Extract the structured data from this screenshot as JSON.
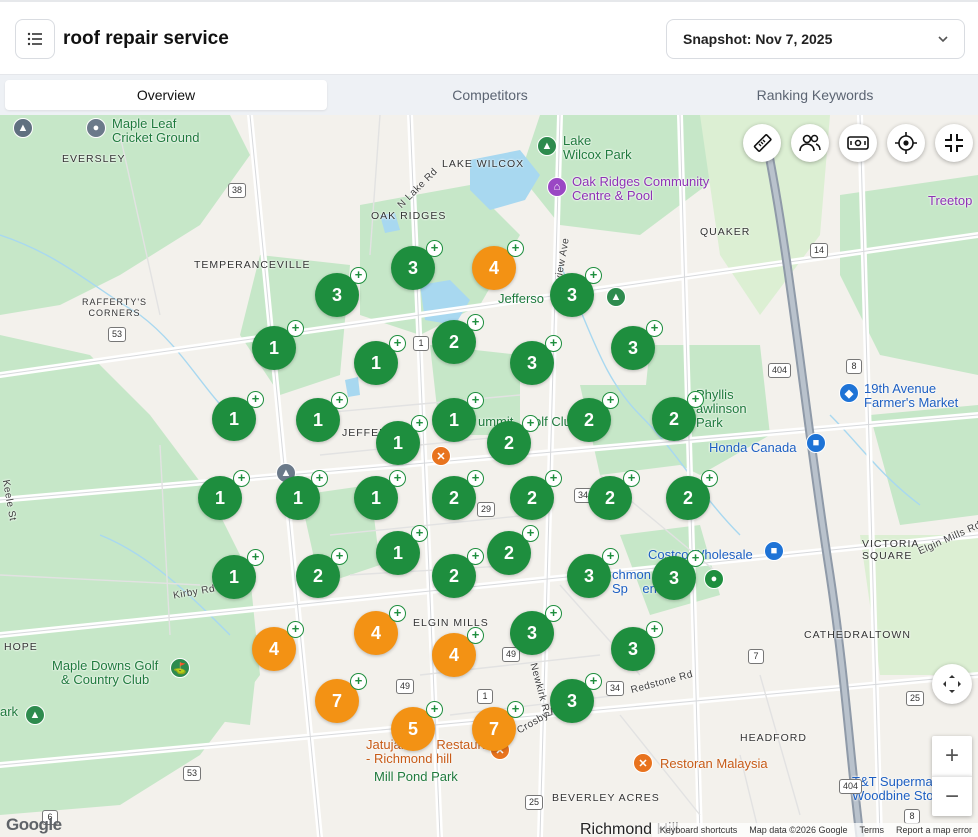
{
  "header": {
    "menu_icon": "list-icon",
    "title": "roof repair service",
    "snapshot_label": "Snapshot: Nov 7, 2025",
    "snapshot_icon": "chevron-down-icon"
  },
  "tabs": [
    {
      "label": "Overview",
      "active": true
    },
    {
      "label": "Competitors",
      "active": false
    },
    {
      "label": "Ranking Keywords",
      "active": false
    }
  ],
  "map": {
    "labels": {
      "maple_leaf": "Maple Leaf\nCricket Ground",
      "eversley": "EVERSLEY",
      "lake_wilcox": "LAKE WILCOX",
      "lake_wilcox_park": "Lake\nWilcox Park",
      "oak_ridges_pool": "Oak Ridges Community\nCentre & Pool",
      "n_lake_rd": "N Lake Rd",
      "oak_ridges": "OAK RIDGES",
      "quaker": "QUAKER",
      "treetop": "Treetop",
      "temperanceville": "TEMPERANCEVILLE",
      "bayview": "Bayview Ave",
      "jefferson": "Jefferso",
      "rafferty": "RAFFERTY'S\nCORNERS",
      "phyllis": "Phyllis\nawlinson\nPark",
      "farmers_market": "19th Avenue\nFarmer's Market",
      "jeffer": "JEFFER",
      "summit": "ummit",
      "golf_club": "olf Clu",
      "honda": "Honda Canada",
      "keele": "Keele St",
      "victoria_square": "VICTORIA\nSQUARE",
      "elgin_mills_rd": "Elgin Mills Rd",
      "costco": "Costco Wholesale",
      "richmond_centre": "chmon\nSp    entre a",
      "kirby": "Kirby Rd",
      "elgin_mills": "ELGIN MILLS",
      "cathedraltown": "CATHEDRALTOWN",
      "hope": "HOPE",
      "maple_downs": "Maple Downs Golf\n& Country Club",
      "redstone": "Redstone Rd",
      "newkirk": "Newkirk Rd",
      "crosby": "Crosby A",
      "park": "ark",
      "jatujak": "Jatujak T     Restaurant\n- Richmond hill",
      "mill_pond": "Mill Pond Park",
      "headford": "HEADFORD",
      "restoran": "Restoran Malaysia",
      "beverley": "BEVERLEY ACRES",
      "tt": "T&T Supermarke\nWoodbine Store",
      "richmond": "Richmond Hill",
      "google": "Google",
      "keyboard": "Keyboard shortcuts",
      "map_data": "Map data ©2026 Google",
      "terms": "Terms",
      "report": "Report a map error"
    },
    "shields": [
      "38",
      "53",
      "1",
      "14",
      "8",
      "404",
      "29",
      "34",
      "49",
      "7",
      "25",
      "6",
      "8",
      "404",
      "53",
      "1",
      "49",
      "34",
      "25"
    ],
    "markers": [
      {
        "rank": "3",
        "color": "green"
      },
      {
        "rank": "4",
        "color": "orange"
      },
      {
        "rank": "3",
        "color": "green"
      },
      {
        "rank": "3",
        "color": "green"
      },
      {
        "rank": "1",
        "color": "green"
      },
      {
        "rank": "1",
        "color": "green"
      },
      {
        "rank": "2",
        "color": "green"
      },
      {
        "rank": "3",
        "color": "green"
      },
      {
        "rank": "3",
        "color": "green"
      },
      {
        "rank": "1",
        "color": "green"
      },
      {
        "rank": "1",
        "color": "green"
      },
      {
        "rank": "1",
        "color": "green"
      },
      {
        "rank": "1",
        "color": "green"
      },
      {
        "rank": "2",
        "color": "green"
      },
      {
        "rank": "2",
        "color": "green"
      },
      {
        "rank": "2",
        "color": "green"
      },
      {
        "rank": "1",
        "color": "green"
      },
      {
        "rank": "1",
        "color": "green"
      },
      {
        "rank": "1",
        "color": "green"
      },
      {
        "rank": "2",
        "color": "green"
      },
      {
        "rank": "2",
        "color": "green"
      },
      {
        "rank": "2",
        "color": "green"
      },
      {
        "rank": "2",
        "color": "green"
      },
      {
        "rank": "1",
        "color": "green"
      },
      {
        "rank": "2",
        "color": "green"
      },
      {
        "rank": "1",
        "color": "green"
      },
      {
        "rank": "2",
        "color": "green"
      },
      {
        "rank": "2",
        "color": "green"
      },
      {
        "rank": "3",
        "color": "green"
      },
      {
        "rank": "3",
        "color": "green"
      },
      {
        "rank": "4",
        "color": "orange"
      },
      {
        "rank": "4",
        "color": "orange"
      },
      {
        "rank": "4",
        "color": "orange"
      },
      {
        "rank": "3",
        "color": "green"
      },
      {
        "rank": "3",
        "color": "green"
      },
      {
        "rank": "7",
        "color": "orange"
      },
      {
        "rank": "5",
        "color": "orange"
      },
      {
        "rank": "7",
        "color": "orange"
      },
      {
        "rank": "3",
        "color": "green"
      }
    ],
    "controls": {
      "ruler": "ruler-icon",
      "people": "people-icon",
      "ticket": "ticket-icon",
      "locate": "crosshair-icon",
      "collapse": "collapse-icon",
      "pan": "pan-icon",
      "zoom_in": "+",
      "zoom_out": "−"
    }
  },
  "colors": {
    "rank_green": "#1e8e3e",
    "rank_orange": "#f39214",
    "park_green": "#c8e6c9",
    "water": "#a8d8f0",
    "road": "#ffffff"
  }
}
